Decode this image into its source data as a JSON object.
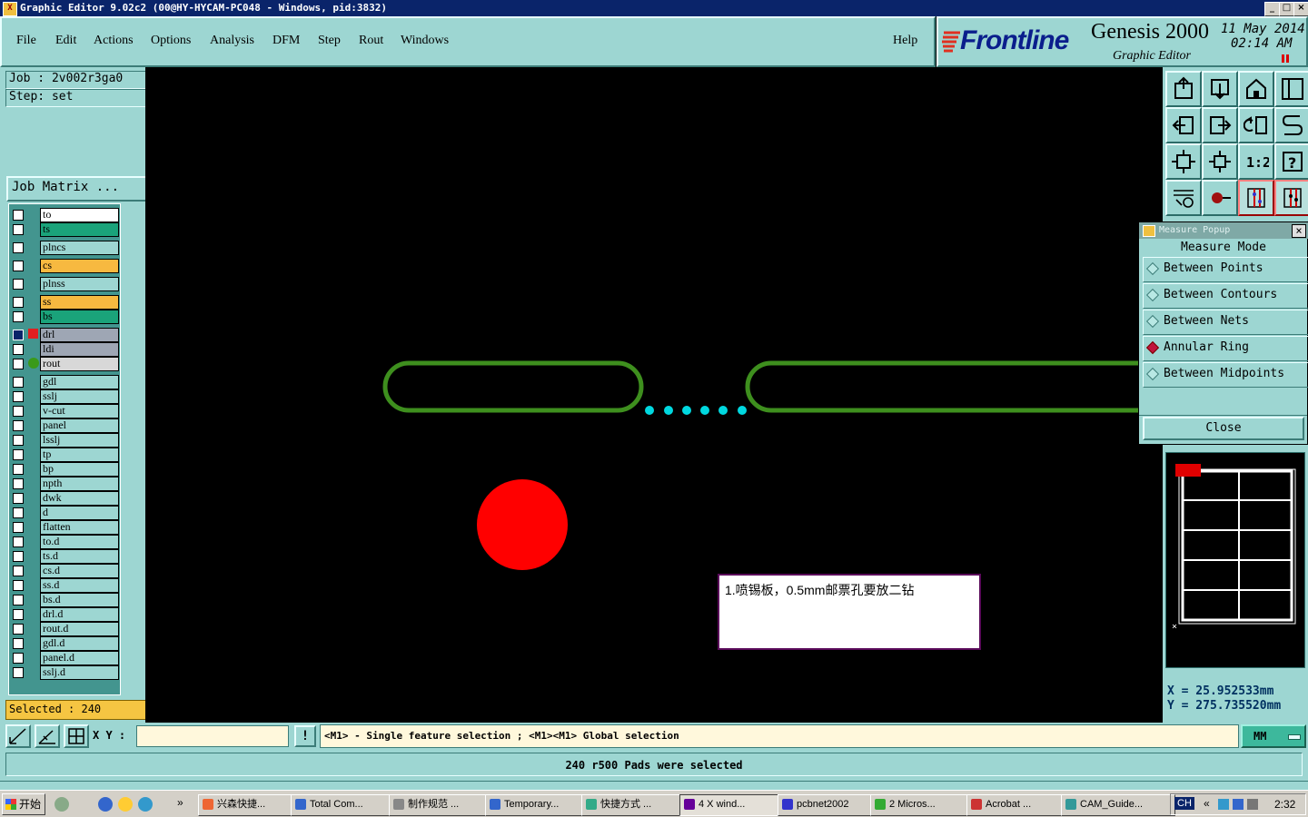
{
  "window": {
    "title": "Graphic Editor 9.02c2 (00@HY-HYCAM-PC048 - Windows, pid:3832)",
    "icon": "x-app-icon"
  },
  "menu": {
    "items": [
      "File",
      "Edit",
      "Actions",
      "Options",
      "Analysis",
      "DFM",
      "Step",
      "Rout",
      "Windows"
    ],
    "help": "Help"
  },
  "brand": {
    "logo": "Frontline",
    "product": "Genesis 2000",
    "subtitle": "Graphic Editor",
    "date": "11 May 2014",
    "time": "02:14 AM"
  },
  "job": {
    "job_label": "Job : 2v002r3ga0",
    "step_label": "Step: set",
    "matrix_button": "Job Matrix ..."
  },
  "layers": [
    {
      "name": "to",
      "color": "#ffffff",
      "marker": ""
    },
    {
      "name": "ts",
      "color": "#1aa37a",
      "marker": ""
    },
    {
      "name": "plncs",
      "color": "#9dd6d2",
      "marker": ""
    },
    {
      "name": "cs",
      "color": "#f7b940",
      "marker": ""
    },
    {
      "name": "plnss",
      "color": "#9dd6d2",
      "marker": ""
    },
    {
      "name": "ss",
      "color": "#f7b940",
      "marker": ""
    },
    {
      "name": "bs",
      "color": "#1aa37a",
      "marker": ""
    },
    {
      "name": "drl",
      "color": "#9ea6b4",
      "marker": "edit"
    },
    {
      "name": "ldi",
      "color": "#9ea6b4",
      "marker": ""
    },
    {
      "name": "rout",
      "color": "#d8d8d8",
      "marker": "dot"
    },
    {
      "name": "gdl",
      "color": "#9dd6d2",
      "marker": ""
    },
    {
      "name": "sslj",
      "color": "#9dd6d2",
      "marker": ""
    },
    {
      "name": "v-cut",
      "color": "#9dd6d2",
      "marker": ""
    },
    {
      "name": "panel",
      "color": "#9dd6d2",
      "marker": ""
    },
    {
      "name": "lsslj",
      "color": "#9dd6d2",
      "marker": ""
    },
    {
      "name": "tp",
      "color": "#9dd6d2",
      "marker": ""
    },
    {
      "name": "bp",
      "color": "#9dd6d2",
      "marker": ""
    },
    {
      "name": "npth",
      "color": "#9dd6d2",
      "marker": ""
    },
    {
      "name": "dwk",
      "color": "#9dd6d2",
      "marker": ""
    },
    {
      "name": "d",
      "color": "#9dd6d2",
      "marker": ""
    },
    {
      "name": "flatten",
      "color": "#9dd6d2",
      "marker": ""
    },
    {
      "name": "to.d",
      "color": "#9dd6d2",
      "marker": ""
    },
    {
      "name": "ts.d",
      "color": "#9dd6d2",
      "marker": ""
    },
    {
      "name": "cs.d",
      "color": "#9dd6d2",
      "marker": ""
    },
    {
      "name": "ss.d",
      "color": "#9dd6d2",
      "marker": ""
    },
    {
      "name": "bs.d",
      "color": "#9dd6d2",
      "marker": ""
    },
    {
      "name": "drl.d",
      "color": "#9dd6d2",
      "marker": ""
    },
    {
      "name": "rout.d",
      "color": "#9dd6d2",
      "marker": ""
    },
    {
      "name": "gdl.d",
      "color": "#9dd6d2",
      "marker": ""
    },
    {
      "name": "panel.d",
      "color": "#9dd6d2",
      "marker": ""
    },
    {
      "name": "sslj.d",
      "color": "#9dd6d2",
      "marker": ""
    }
  ],
  "selected": "Selected : 240",
  "canvas": {
    "note": "1.喷锡板，0.5mm邮票孔要放二钻"
  },
  "tools": [
    "export-up-icon",
    "import-down-icon",
    "home-icon",
    "split-view-icon",
    "pan-left-icon",
    "pan-right-icon",
    "undo-swap-icon",
    "snap-icon",
    "zoom-fit-icon",
    "zoom-center-icon",
    "zoom-1-2-icon",
    "help-icon",
    "settings-icon",
    "pad-icon",
    "measure-red-icon",
    "measure-active-icon"
  ],
  "tool_labels": {
    "ratio": "1:2",
    "help": "?"
  },
  "measure_popup": {
    "title": "Measure Popup",
    "header": "Measure Mode",
    "options": [
      {
        "label": "Between Points",
        "selected": false
      },
      {
        "label": "Between Contours",
        "selected": false
      },
      {
        "label": "Between Nets",
        "selected": false
      },
      {
        "label": "Annular Ring",
        "selected": true
      },
      {
        "label": "Between Midpoints",
        "selected": false
      }
    ],
    "close": "Close"
  },
  "coords": {
    "x": "X = 25.952533mm",
    "y": "Y = 275.735520mm"
  },
  "command": {
    "xy_label": "X Y :",
    "xy_value": "",
    "hint": "<M1> - Single feature selection ; <M1><M1> Global selection",
    "units": "MM"
  },
  "message": "240 r500 Pads were selected",
  "taskbar": {
    "start": "开始",
    "tasks": [
      "兴森快捷...",
      "Total Com...",
      "制作规范 ...",
      "Temporary...",
      "快捷方式 ...",
      "4 X wind...",
      "pcbnet2002",
      "2 Micros...",
      "Acrobat ...",
      "CAM_Guide..."
    ],
    "lang": "CH",
    "clock": "2:32"
  }
}
